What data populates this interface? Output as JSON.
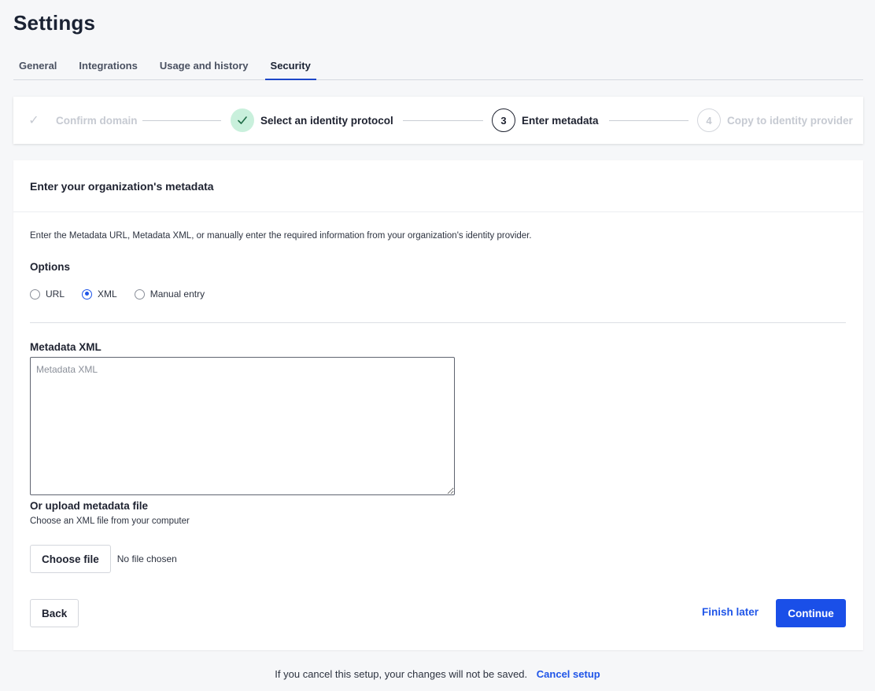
{
  "page": {
    "title": "Settings"
  },
  "tabs": [
    {
      "label": "General",
      "active": false
    },
    {
      "label": "Integrations",
      "active": false
    },
    {
      "label": "Usage and history",
      "active": false
    },
    {
      "label": "Security",
      "active": true
    }
  ],
  "stepper": {
    "steps": [
      {
        "label": "Confirm domain",
        "state": "completed",
        "icon": "check-icon"
      },
      {
        "label": "Select an identity protocol",
        "state": "completed",
        "icon": "check-icon"
      },
      {
        "number": "3",
        "label": "Enter metadata",
        "state": "current"
      },
      {
        "number": "4",
        "label": "Copy to identity provider",
        "state": "pending"
      }
    ]
  },
  "card": {
    "header": "Enter your organization's metadata",
    "description": "Enter the Metadata URL, Metadata XML, or manually enter the required information from your organization's identity provider.",
    "options_title": "Options",
    "options": [
      {
        "label": "URL",
        "checked": false
      },
      {
        "label": "XML",
        "checked": true
      },
      {
        "label": "Manual entry",
        "checked": false
      }
    ],
    "xml_title": "Metadata XML",
    "xml_placeholder": "Metadata XML",
    "xml_value": "",
    "upload_title": "Or upload metadata file",
    "upload_description": "Choose an XML file from your computer",
    "choose_file_label": "Choose file",
    "file_status": "No file chosen",
    "back_label": "Back",
    "finish_later_label": "Finish later",
    "continue_label": "Continue"
  },
  "footer": {
    "note": "If you cancel this setup, your changes will not be saved.",
    "cancel_label": "Cancel setup"
  },
  "colors": {
    "accent": "#1a4fe8",
    "success_bg": "#c9f0dc",
    "text": "#1e2230"
  }
}
